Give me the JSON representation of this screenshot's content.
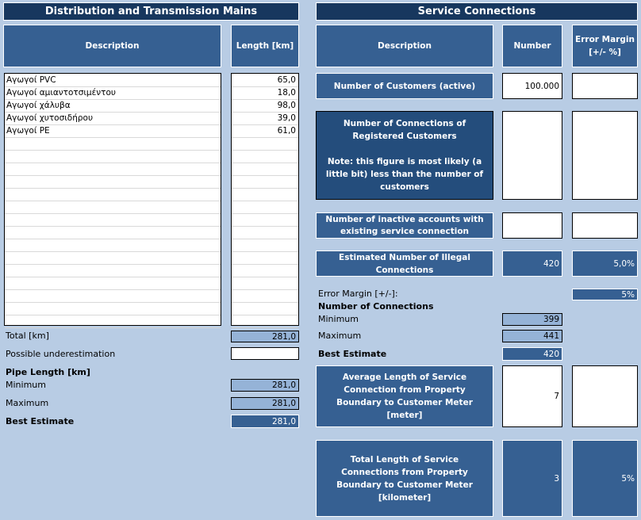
{
  "left": {
    "title": "Distribution and Transmission Mains",
    "col_description": "Description",
    "col_length": "Length [km]",
    "rows": [
      {
        "description": "Αγωγοί PVC",
        "length": "65,0"
      },
      {
        "description": "Αγωγοί αμιαντοτσιμέντου",
        "length": "18,0"
      },
      {
        "description": "Αγωγοί χάλυβα",
        "length": "98,0"
      },
      {
        "description": "Αγωγοί χυτοσιδήρου",
        "length": "39,0"
      },
      {
        "description": "Αγωγοί PE",
        "length": "61,0"
      }
    ],
    "total_label": "Total [km]",
    "total_value": "281,0",
    "underestimation_label": "Possible underestimation",
    "underestimation_value": "",
    "pipe_length_label": "Pipe Length [km]",
    "minimum_label": "Minimum",
    "minimum_value": "281,0",
    "maximum_label": "Maximum",
    "maximum_value": "281,0",
    "best_label": "Best Estimate",
    "best_value": "281,0"
  },
  "right": {
    "title": "Service Connections",
    "col_description": "Description",
    "col_number": "Number",
    "col_error": "Error Margin [+/- %]",
    "customers_label": "Number of Customers (active)",
    "customers_value": "100.000",
    "customers_error": "",
    "registered_label": "Number of Connections of Registered Customers",
    "registered_note": "Note: this figure is most likely (a little bit) less than the number of customers",
    "registered_value": "",
    "registered_error": "",
    "inactive_label": "Number of inactive accounts with existing service connection",
    "inactive_value": "",
    "inactive_error": "",
    "illegal_label": "Estimated Number of Illegal Connections",
    "illegal_value": "420",
    "illegal_error": "5,0%",
    "error_margin_label": "Error Margin [+/-]:",
    "error_margin_value": "5%",
    "connections_label": "Number of Connections",
    "minimum_label": "Minimum",
    "minimum_value": "399",
    "maximum_label": "Maximum",
    "maximum_value": "441",
    "best_label": "Best Estimate",
    "best_value": "420",
    "avg_label": "Average Length of Service Connection from Property Boundary to Customer Meter [meter]",
    "avg_value": "7",
    "avg_error": "",
    "total_label": "Total Length of Service Connections from Property Boundary to Customer Meter [kilometer]",
    "total_value": "3",
    "total_error": "5%"
  }
}
